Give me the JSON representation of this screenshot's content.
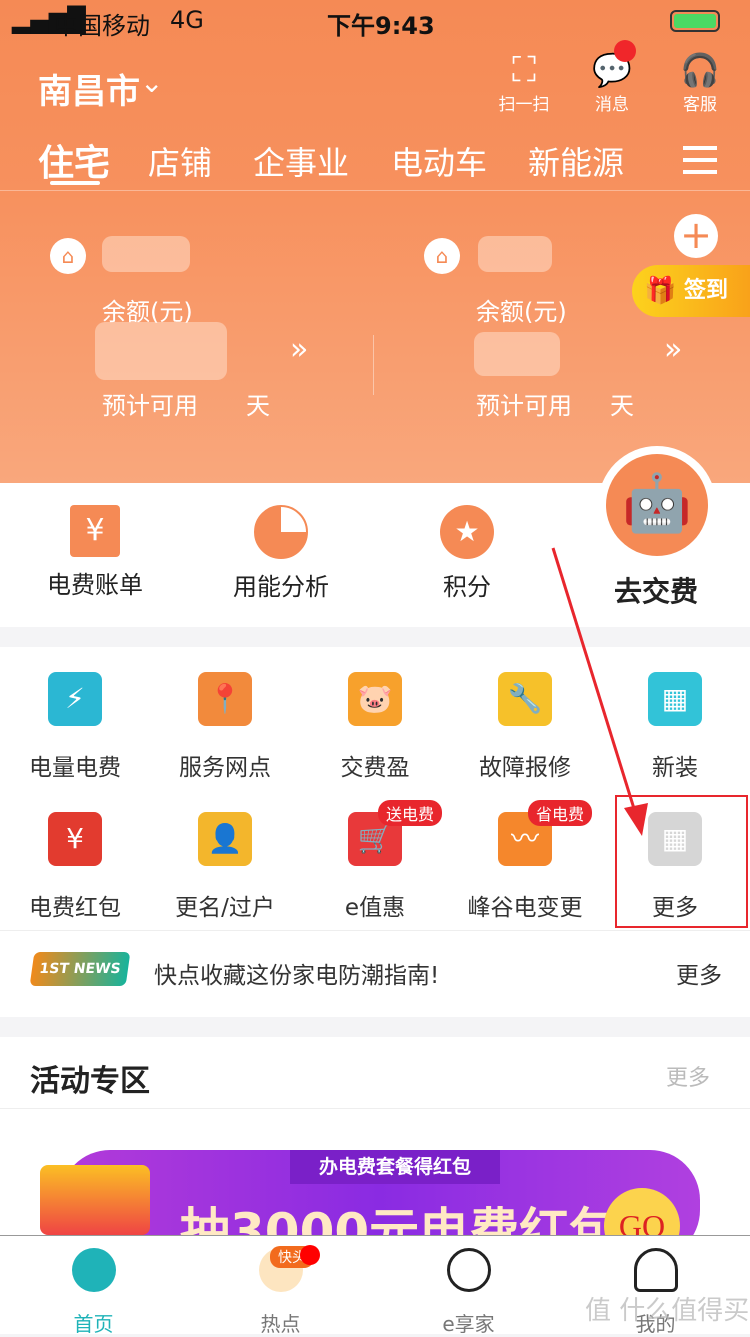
{
  "status": {
    "carrier": "中国移动",
    "network": "4G",
    "time": "下午9:43"
  },
  "header": {
    "city": "南昌市",
    "scan": "扫一扫",
    "message": "消息",
    "service": "客服"
  },
  "tabs": [
    "住宅",
    "店铺",
    "企事业",
    "电动车",
    "新能源"
  ],
  "accounts": [
    {
      "balance_label": "余额(元)",
      "days_prefix": "预计可用",
      "days_suffix": "天"
    },
    {
      "balance_label": "余额(元)",
      "days_prefix": "预计可用",
      "days_suffix": "天"
    }
  ],
  "signin": "签到",
  "quick": [
    "电费账单",
    "用能分析",
    "积分",
    "去交费"
  ],
  "grid": [
    {
      "label": "电量电费",
      "color": "#2bb7d3"
    },
    {
      "label": "服务网点",
      "color": "#f28a3c"
    },
    {
      "label": "交费盈",
      "color": "#f7a12c"
    },
    {
      "label": "故障报修",
      "color": "#f6c12a"
    },
    {
      "label": "新装",
      "color": "#32c3d8"
    },
    {
      "label": "电费红包",
      "color": "#e23b2f"
    },
    {
      "label": "更名/过户",
      "color": "#f3b62c"
    },
    {
      "label": "e值惠",
      "color": "#e8393a",
      "badge": "送电费"
    },
    {
      "label": "峰谷电变更",
      "color": "#f5872c",
      "badge": "省电费"
    },
    {
      "label": "更多",
      "color": "#d6d6d6"
    }
  ],
  "news": {
    "logo": "1ST NEWS 头条",
    "text": "快点收藏这份家电防潮指南!",
    "more": "更多"
  },
  "activity": {
    "title": "活动专区",
    "more": "更多",
    "banner_tag": "办电费套餐得红包",
    "banner_text": "抽3000元电费红包",
    "banner_go": "GO"
  },
  "bottom_nav": [
    {
      "label": "首页",
      "active": true
    },
    {
      "label": "热点",
      "badge": "快头"
    },
    {
      "label": "e享家"
    },
    {
      "label": "我的"
    }
  ],
  "watermark": "值 什么值得买",
  "accent": "#f58a55"
}
